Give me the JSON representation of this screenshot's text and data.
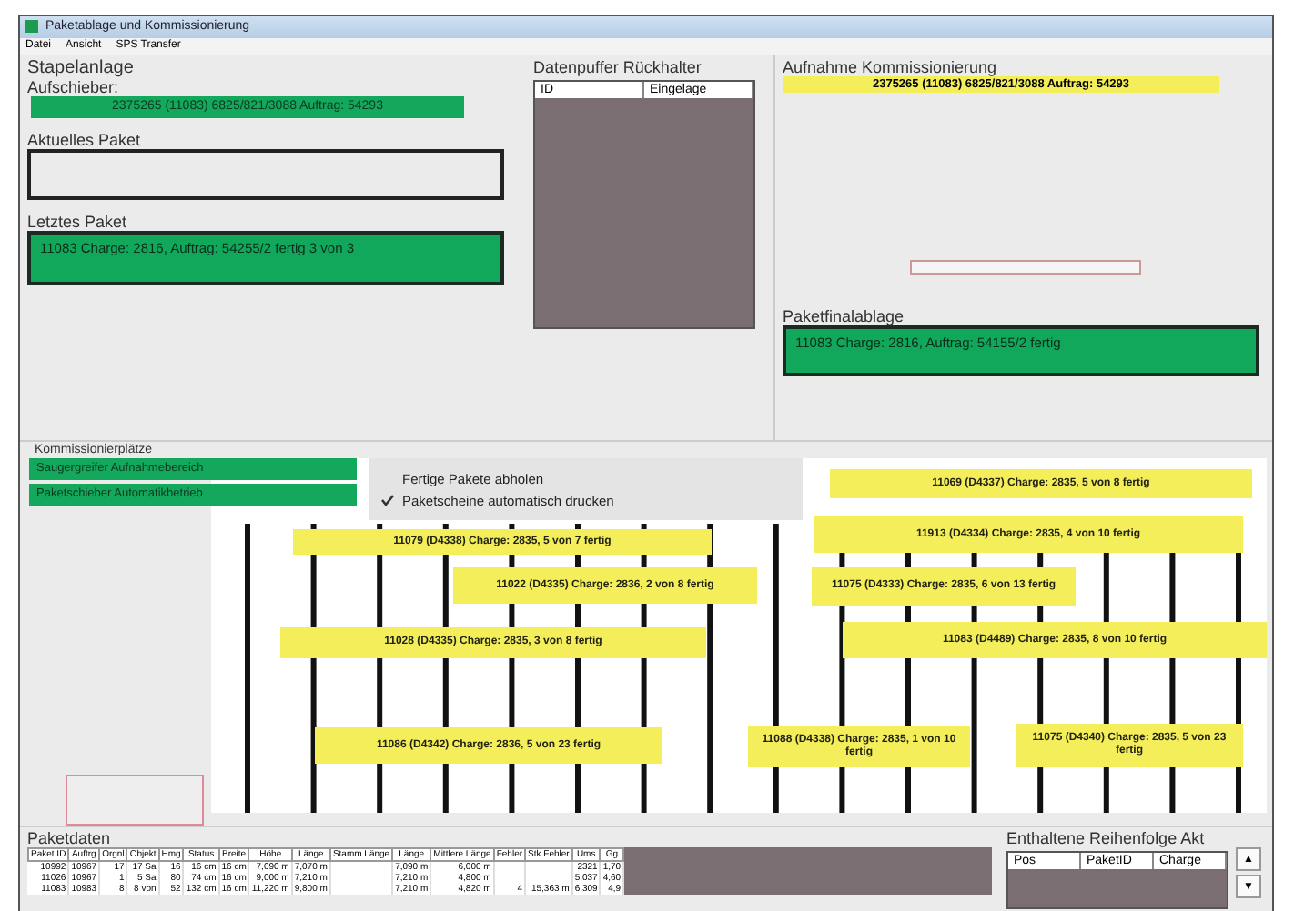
{
  "window": {
    "title": "Paketablage und Kommissionierung"
  },
  "menu": [
    "Datei",
    "Ansicht",
    "SPS Transfer"
  ],
  "stapelanlage": {
    "title": "Stapelanlage",
    "aufschieber_label": "Aufschieber:",
    "aufschieber": "2375265 (11083) 6825/821/3088 Auftrag: 54293",
    "aktuelles_label": "Aktuelles Paket",
    "letztes_label": "Letztes Paket",
    "letztes": "11083 Charge: 2816, Auftrag: 54255/2 fertig    3 von 3"
  },
  "datenpuffer": {
    "title": "Datenpuffer Rückhalter",
    "columns": [
      "ID",
      "Eingelage"
    ]
  },
  "aufnahme": {
    "title": "Aufnahme Kommissionierung",
    "current": "2375265 (11083) 6825/821/3088 Auftrag: 54293",
    "progress": {
      "level": 0
    }
  },
  "finalablage": {
    "title": "Paketfinalablage",
    "text": "11083 Charge: 2816, Auftrag: 54155/2 fertig"
  },
  "kommissionier": {
    "title": "Kommissionierplätze",
    "status": [
      "Saugergreifer Aufnahmebereich",
      "Paketschieber Automatikbetrieb"
    ],
    "options": [
      {
        "label": "Fertige Pakete abholen",
        "checked": false
      },
      {
        "label": "Paketscheine automatisch drucken",
        "checked": true
      }
    ],
    "packages": [
      {
        "text": "11079 (D4338)    Charge: 2835, 5 von 7 fertig"
      },
      {
        "text": "11022 (D4335) Charge: 2836, 2 von 8 fertig"
      },
      {
        "text": "11028 (D4335) Charge: 2835, 3 von 8 fertig"
      },
      {
        "text": "11086 (D4342) Charge: 2836, 5 von 23 fertig"
      },
      {
        "text": "11069 (D4337)   Charge: 2835, 5 von 8 fertig"
      },
      {
        "text": "11913 (D4334)   Charge: 2835, 4 von 10 fertig"
      },
      {
        "text": "11075 (D4333) Charge: 2835, 6 von 13 fertig"
      },
      {
        "text": "11083 (D4489)          Charge: 2835, 8 von 10 fertig"
      },
      {
        "text": "11088 (D4338) Charge: 2835, 1 von 10 fertig"
      },
      {
        "text": "11075 (D4340) Charge: 2835, 5 von 23 fertig"
      }
    ]
  },
  "paketdaten": {
    "title": "Paketdaten",
    "columns": [
      "Paket ID",
      "Auftrg",
      "Orgnl",
      "Objekt",
      "Hmg",
      "Status",
      "Breite",
      "Höhe",
      "Länge",
      "Stamm Länge",
      "Länge",
      "Mittlere Länge",
      "Fehler",
      "Stk.Fehler",
      "Ums",
      "Gg"
    ],
    "rows": [
      [
        "10992",
        "10967",
        "17",
        "17 Sa",
        "16",
        "16 cm",
        "16 cm",
        "7,090 m",
        "7,070 m",
        "",
        "7,090 m",
        "6,000 m",
        "",
        "",
        "2321",
        "1,70"
      ],
      [
        "11026",
        "10967",
        "1",
        "5 Sa",
        "80",
        "74 cm",
        "16 cm",
        "9,000 m",
        "7,210 m",
        "",
        "7,210 m",
        "4,800 m",
        "",
        "",
        "5,037",
        "4,60"
      ],
      [
        "11083",
        "10983",
        "8",
        "8 von",
        "52",
        "132 cm",
        "16 cm",
        "11,220 m",
        "9,800 m",
        "",
        "7,210 m",
        "4,820 m",
        "4",
        "15,363 m",
        "6,309",
        "4,9"
      ]
    ]
  },
  "reihenfolge": {
    "title": "Enthaltene Reihenfolge Akt",
    "columns": [
      "Pos",
      "PaketID",
      "Charge"
    ],
    "buttons": [
      "▲",
      "▼"
    ]
  }
}
